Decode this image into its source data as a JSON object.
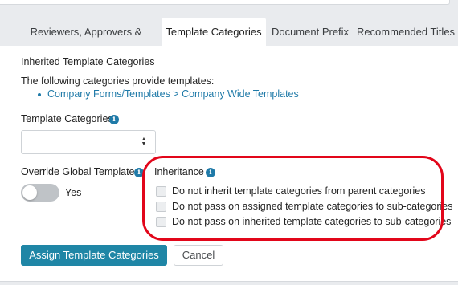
{
  "tabs": [
    {
      "label": "Reviewers, Approvers & Notifiers",
      "active": false
    },
    {
      "label": "Template Categories",
      "active": true
    },
    {
      "label": "Document Prefix",
      "active": false
    },
    {
      "label": "Recommended Titles",
      "active": false
    }
  ],
  "inherited": {
    "heading": "Inherited Template Categories",
    "intro": "The following categories provide templates:",
    "items": [
      "Company Forms/Templates > Company Wide Templates"
    ]
  },
  "template_categories": {
    "label": "Template Categories",
    "info_icon": "info-icon",
    "select_value": ""
  },
  "override": {
    "label": "Override Global Templates",
    "toggle_on": false,
    "toggle_text": "Yes"
  },
  "inheritance": {
    "label": "Inheritance",
    "options": [
      {
        "label": "Do not inherit template categories from parent categories",
        "checked": false
      },
      {
        "label": "Do not pass on assigned template categories to sub-categories",
        "checked": false
      },
      {
        "label": "Do not pass on inherited template categories to sub-categories",
        "checked": false
      }
    ]
  },
  "actions": {
    "primary": "Assign Template Categories",
    "secondary": "Cancel"
  },
  "colors": {
    "accent": "#1f86a6",
    "link": "#1f7aa8",
    "highlight": "#e2061a",
    "background": "#e9ebee"
  }
}
